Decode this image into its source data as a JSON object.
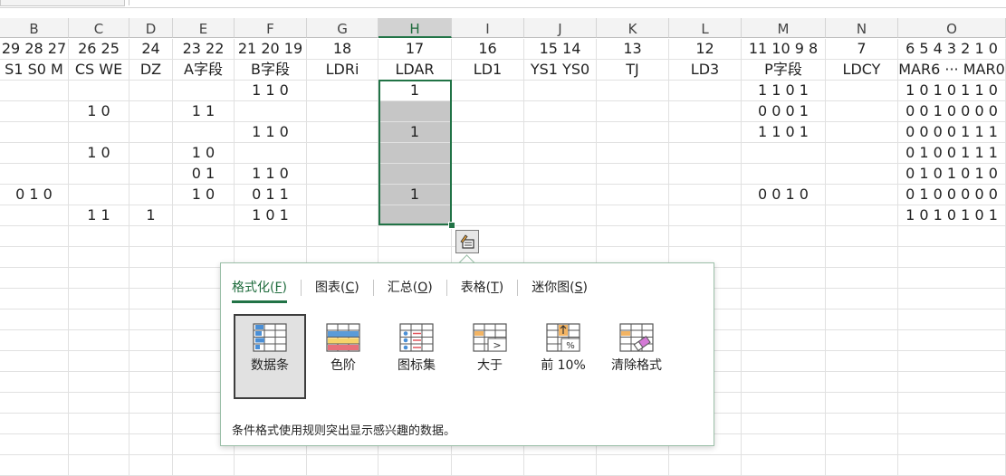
{
  "columns": [
    {
      "letter": "B",
      "row1": "29 28 27",
      "row2": "S1 S0 M"
    },
    {
      "letter": "C",
      "row1": "26 25",
      "row2": "CS WE"
    },
    {
      "letter": "D",
      "row1": "24",
      "row2": "DZ"
    },
    {
      "letter": "E",
      "row1": "23 22",
      "row2": "A字段"
    },
    {
      "letter": "F",
      "row1": "21 20 19",
      "row2": "B字段"
    },
    {
      "letter": "G",
      "row1": "18",
      "row2": "LDRi"
    },
    {
      "letter": "H",
      "row1": "17",
      "row2": "LDAR"
    },
    {
      "letter": "I",
      "row1": "16",
      "row2": "LD1"
    },
    {
      "letter": "J",
      "row1": "15 14",
      "row2": "YS1 YS0"
    },
    {
      "letter": "K",
      "row1": "13",
      "row2": "TJ"
    },
    {
      "letter": "L",
      "row1": "12",
      "row2": "LD3"
    },
    {
      "letter": "M",
      "row1": "11 10 9 8",
      "row2": "P字段"
    },
    {
      "letter": "N",
      "row1": "7",
      "row2": "LDCY"
    },
    {
      "letter": "O",
      "row1": "6 5 4 3 2 1 0",
      "row2": "MAR6 ··· MAR0"
    }
  ],
  "rows": [
    [
      "",
      "",
      "",
      "",
      "1 1 0",
      "",
      "1",
      "",
      "",
      "",
      "",
      "1 1 0 1",
      "",
      "1 0 1 0 1 1 0"
    ],
    [
      "",
      "1 0",
      "",
      "1 1",
      "",
      "",
      "",
      "",
      "",
      "",
      "",
      "0 0 0 1",
      "",
      "0 0 1 0 0 0 0"
    ],
    [
      "",
      "",
      "",
      "",
      "1 1 0",
      "",
      "1",
      "",
      "",
      "",
      "",
      "1 1 0 1",
      "",
      "0 0 0 0 1 1 1"
    ],
    [
      "",
      "1 0",
      "",
      "1 0",
      "",
      "",
      "",
      "",
      "",
      "",
      "",
      "",
      "",
      "0 1 0 0 1 1 1"
    ],
    [
      "",
      "",
      "",
      "0 1",
      "1 1 0",
      "",
      "",
      "",
      "",
      "",
      "",
      "",
      "",
      "0 1 0 1 0 1 0"
    ],
    [
      "0 1 0",
      "",
      "",
      "1 0",
      "0 1 1",
      "",
      "1",
      "",
      "",
      "",
      "",
      "0 0 1 0",
      "",
      "0 1 0 0 0 0 0"
    ],
    [
      "",
      "1 1",
      "1",
      "",
      "1 0 1",
      "",
      "",
      "",
      "",
      "",
      "",
      "",
      "",
      "1 0 1 0 1 0 1"
    ]
  ],
  "quick_analysis": {
    "tabs": [
      {
        "label": "格式化(",
        "key": "F",
        "suffix": ")",
        "active": true
      },
      {
        "label": "图表(",
        "key": "C",
        "suffix": ")",
        "active": false
      },
      {
        "label": "汇总(",
        "key": "O",
        "suffix": ")",
        "active": false
      },
      {
        "label": "表格(",
        "key": "T",
        "suffix": ")",
        "active": false
      },
      {
        "label": "迷你图(",
        "key": "S",
        "suffix": ")",
        "active": false
      }
    ],
    "options": [
      {
        "label": "数据条",
        "icon": "data-bars-icon",
        "active": true
      },
      {
        "label": "色阶",
        "icon": "color-scale-icon",
        "active": false
      },
      {
        "label": "图标集",
        "icon": "icon-set-icon",
        "active": false
      },
      {
        "label": "大于",
        "icon": "greater-than-icon",
        "active": false
      },
      {
        "label": "前 10%",
        "icon": "top-10-percent-icon",
        "active": false
      },
      {
        "label": "清除格式",
        "icon": "clear-format-icon",
        "active": false
      }
    ],
    "description": "条件格式使用规则突出显示感兴趣的数据。"
  },
  "colors": {
    "accent": "#217346",
    "selection_fill": "#c6c6c6"
  }
}
